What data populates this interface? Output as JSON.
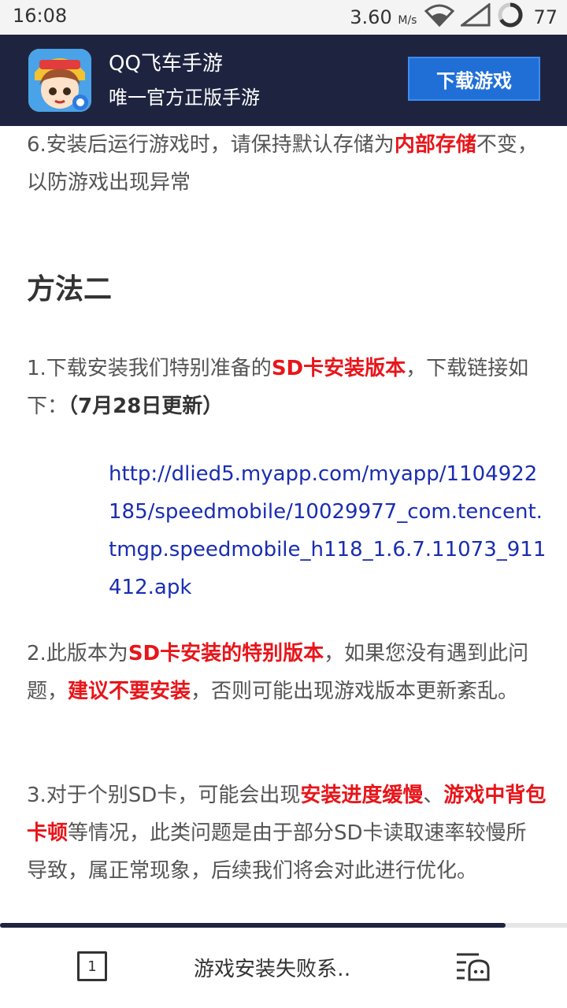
{
  "status_bar": {
    "time": "16:08",
    "net_speed": "3.60",
    "net_unit": "M/s",
    "battery": "77"
  },
  "app_banner": {
    "app_name": "QQ飞车手游",
    "subtitle": "唯一官方正版手游",
    "download_label": "下载游戏"
  },
  "article": {
    "p6_prefix": "6.安装后运行游戏时，请保持默认存储为",
    "p6_red": "内部存储",
    "p6_suffix": "不变，以防游戏出现异常",
    "heading": "方法二",
    "m1_prefix": "1.下载安装我们特别准备的",
    "m1_red": "SD卡安装版本",
    "m1_mid": "，下载链接如下：",
    "m1_bold": "（7月28日更新）",
    "link": "http://dlied5.myapp.com/myapp/1104922185/speedmobile/10029977_com.tencent.tmgp.speedmobile_h118_1.6.7.11073_911412.apk",
    "m2_prefix": "2.此版本为",
    "m2_red1": "SD卡安装的特别版本",
    "m2_mid": "，如果您没有遇到此问题，",
    "m2_red2": "建议不要安装",
    "m2_suffix": "，否则可能出现游戏版本更新紊乱。",
    "m3_prefix": "3.对于个别SD卡，可能会出现",
    "m3_red1": "安装进度缓慢",
    "m3_sep": "、",
    "m3_red2": "游戏中背包卡顿",
    "m3_suffix": "等情况，此类问题是由于部分SD卡读取速率较慢所导致，属正常现象，后续我们将会对此进行优化。"
  },
  "bottom_bar": {
    "tab_count": "1",
    "page_title": "游戏安装失败系‥"
  }
}
